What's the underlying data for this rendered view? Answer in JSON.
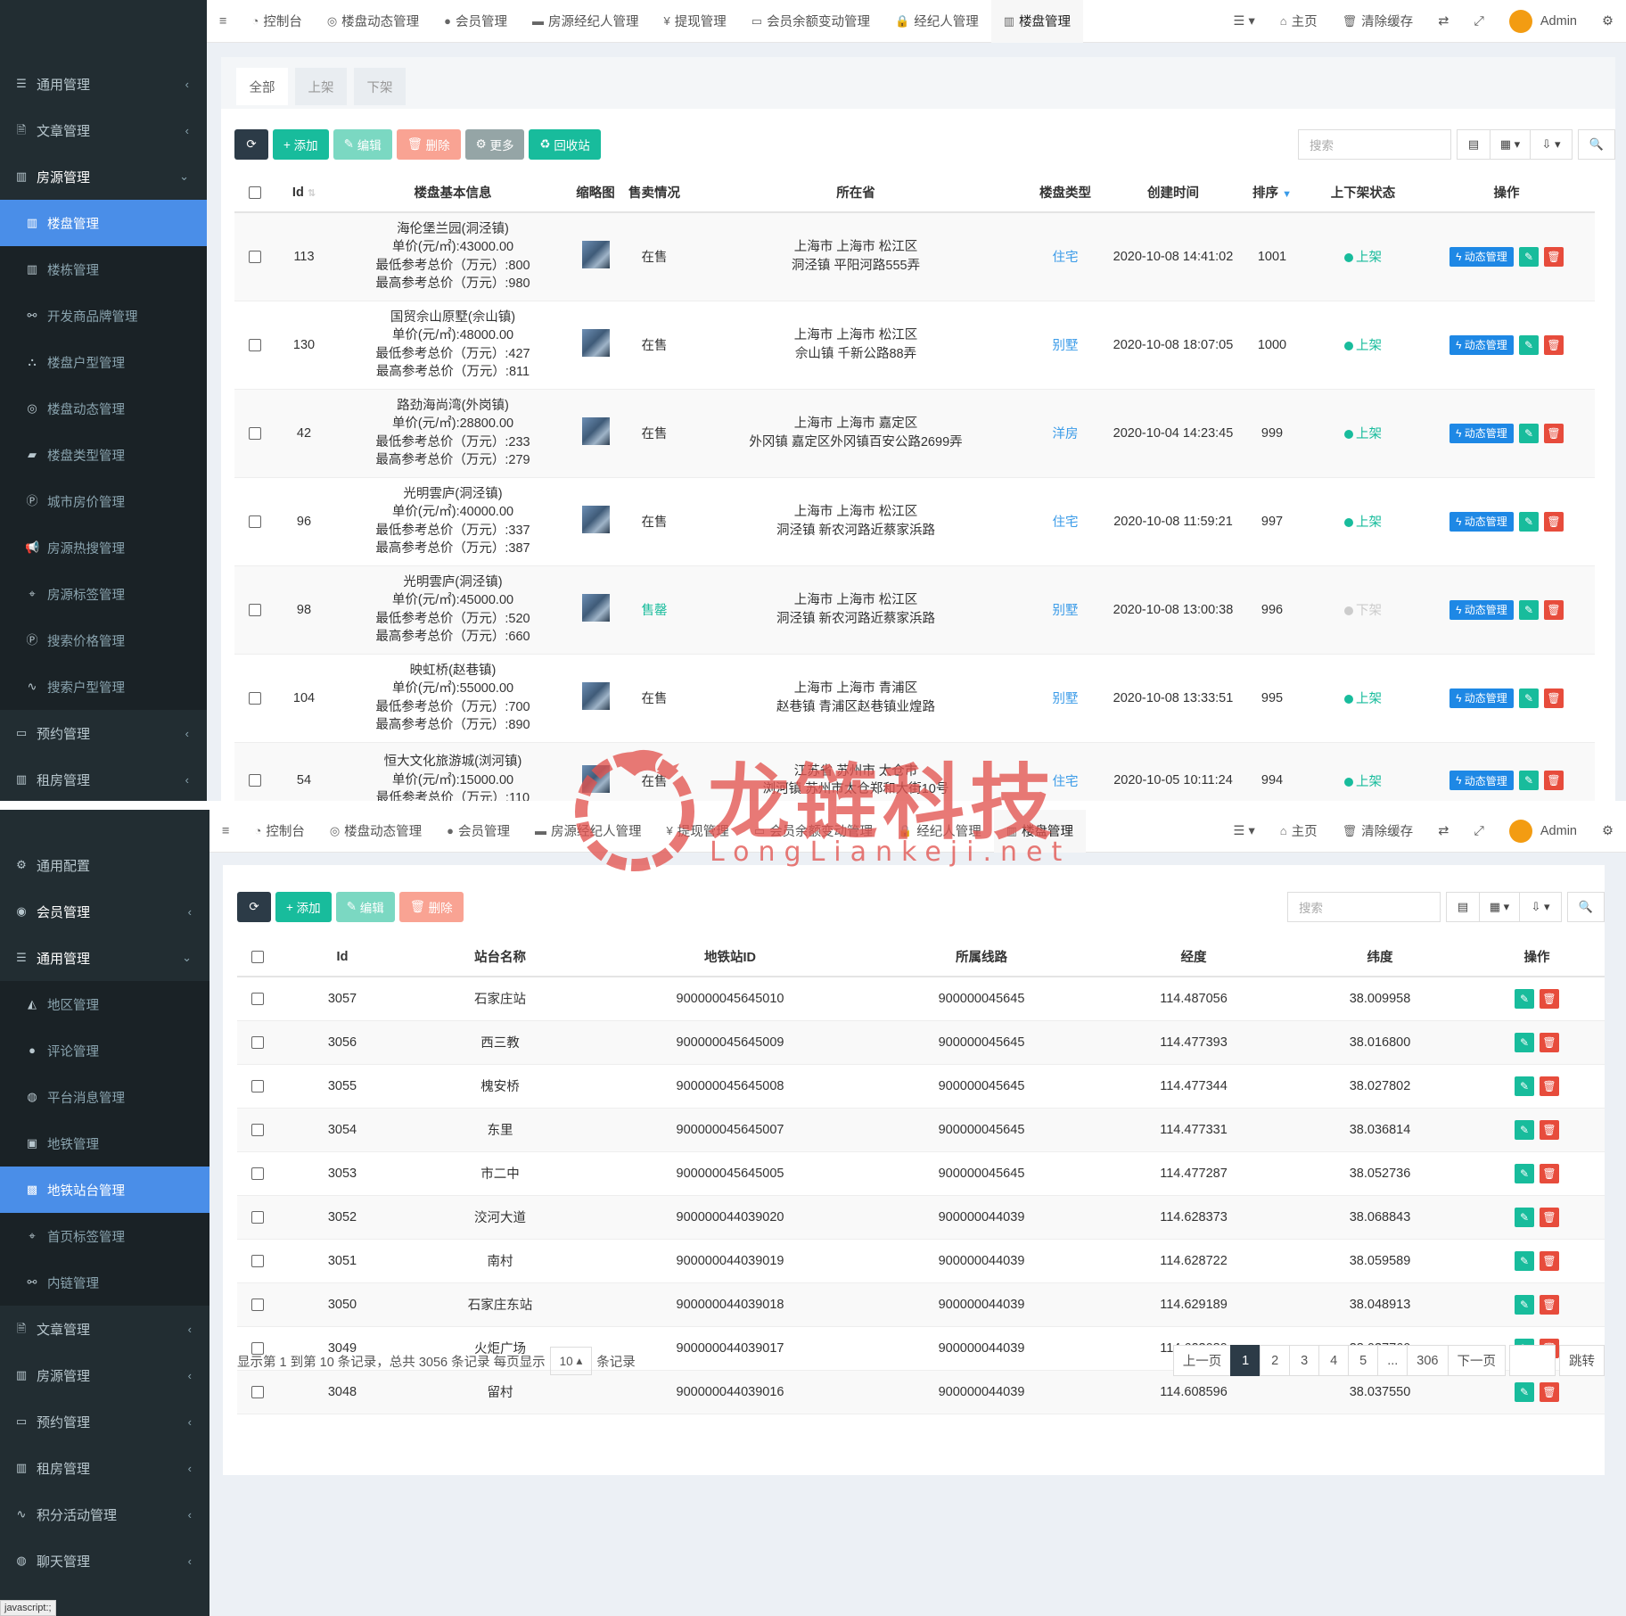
{
  "panel1": {
    "sidebar": [
      {
        "label": "通用管理",
        "icon": "list-icon",
        "kind": "top",
        "arrow": "‹"
      },
      {
        "label": "文章管理",
        "icon": "file-icon",
        "kind": "top",
        "arrow": "‹"
      },
      {
        "label": "房源管理",
        "icon": "building-icon",
        "kind": "top open",
        "arrow": "⌄"
      },
      {
        "label": "楼盘管理",
        "icon": "building-icon",
        "kind": "sub active",
        "arrow": ""
      },
      {
        "label": "楼栋管理",
        "icon": "building-icon",
        "kind": "sub",
        "arrow": ""
      },
      {
        "label": "开发商品牌管理",
        "icon": "link-icon",
        "kind": "sub",
        "arrow": ""
      },
      {
        "label": "楼盘户型管理",
        "icon": "sitemap-icon",
        "kind": "sub",
        "arrow": ""
      },
      {
        "label": "楼盘动态管理",
        "icon": "glasses-icon",
        "kind": "sub",
        "arrow": ""
      },
      {
        "label": "楼盘类型管理",
        "icon": "book-icon",
        "kind": "sub",
        "arrow": ""
      },
      {
        "label": "城市房价管理",
        "icon": "parking-icon",
        "kind": "sub",
        "arrow": ""
      },
      {
        "label": "房源热搜管理",
        "icon": "bullhorn-icon",
        "kind": "sub",
        "arrow": ""
      },
      {
        "label": "房源标签管理",
        "icon": "tag-icon",
        "kind": "sub",
        "arrow": ""
      },
      {
        "label": "搜索价格管理",
        "icon": "parking-icon",
        "kind": "sub",
        "arrow": ""
      },
      {
        "label": "搜索户型管理",
        "icon": "chart-icon",
        "kind": "sub",
        "arrow": ""
      },
      {
        "label": "预约管理",
        "icon": "laptop-icon",
        "kind": "top",
        "arrow": "‹"
      },
      {
        "label": "租房管理",
        "icon": "building-icon",
        "kind": "top",
        "arrow": "‹"
      }
    ],
    "nav": [
      {
        "label": "控制台",
        "icon": "dashboard-icon"
      },
      {
        "label": "楼盘动态管理",
        "icon": "glasses-icon"
      },
      {
        "label": "会员管理",
        "icon": "user-icon"
      },
      {
        "label": "房源经纪人管理",
        "icon": "briefcase-icon"
      },
      {
        "label": "提现管理",
        "icon": "yen-icon"
      },
      {
        "label": "会员余额变动管理",
        "icon": "money-icon"
      },
      {
        "label": "经纪人管理",
        "icon": "lock-icon"
      },
      {
        "label": "楼盘管理",
        "icon": "building-icon"
      }
    ],
    "home": "主页",
    "clear_cache": "清除缓存",
    "admin": "Admin",
    "tabs": [
      "全部",
      "上架",
      "下架"
    ],
    "buttons": {
      "add": "添加",
      "edit": "编辑",
      "delete": "删除",
      "more": "更多",
      "recycle": "回收站"
    },
    "search_placeholder": "搜索",
    "headers": [
      "Id",
      "楼盘基本信息",
      "缩略图",
      "售卖情况",
      "所在省",
      "楼盘类型",
      "创建时间",
      "排序",
      "上下架状态",
      "操作"
    ],
    "op_dynamic": "动态管理",
    "rows": [
      {
        "id": "113",
        "info": [
          "海伦堡兰园(洞泾镇)",
          "单价(元/㎡):43000.00",
          "最低参考总价（万元）:800",
          "最高参考总价（万元）:980"
        ],
        "sale": "在售",
        "sale_green": false,
        "loc": [
          "上海市 上海市 松江区",
          "洞泾镇 平阳河路555弄"
        ],
        "type": "住宅",
        "time": "2020-10-08 14:41:02",
        "sort": "1001",
        "status": "上架",
        "on": true
      },
      {
        "id": "130",
        "info": [
          "国贸佘山原墅(佘山镇)",
          "单价(元/㎡):48000.00",
          "最低参考总价（万元）:427",
          "最高参考总价（万元）:811"
        ],
        "sale": "在售",
        "sale_green": false,
        "loc": [
          "上海市 上海市 松江区",
          "佘山镇 千新公路88弄"
        ],
        "type": "别墅",
        "time": "2020-10-08 18:07:05",
        "sort": "1000",
        "status": "上架",
        "on": true
      },
      {
        "id": "42",
        "info": [
          "路劲海尚湾(外岗镇)",
          "单价(元/㎡):28800.00",
          "最低参考总价（万元）:233",
          "最高参考总价（万元）:279"
        ],
        "sale": "在售",
        "sale_green": false,
        "loc": [
          "上海市 上海市 嘉定区",
          "外冈镇 嘉定区外冈镇百安公路2699弄"
        ],
        "type": "洋房",
        "time": "2020-10-04 14:23:45",
        "sort": "999",
        "status": "上架",
        "on": true
      },
      {
        "id": "96",
        "info": [
          "光明雲庐(洞泾镇)",
          "单价(元/㎡):40000.00",
          "最低参考总价（万元）:337",
          "最高参考总价（万元）:387"
        ],
        "sale": "在售",
        "sale_green": false,
        "loc": [
          "上海市 上海市 松江区",
          "洞泾镇 新农河路近蔡家浜路"
        ],
        "type": "住宅",
        "time": "2020-10-08 11:59:21",
        "sort": "997",
        "status": "上架",
        "on": true
      },
      {
        "id": "98",
        "info": [
          "光明雲庐(洞泾镇)",
          "单价(元/㎡):45000.00",
          "最低参考总价（万元）:520",
          "最高参考总价（万元）:660"
        ],
        "sale": "售罄",
        "sale_green": true,
        "loc": [
          "上海市 上海市 松江区",
          "洞泾镇 新农河路近蔡家浜路"
        ],
        "type": "别墅",
        "time": "2020-10-08 13:00:38",
        "sort": "996",
        "status": "下架",
        "on": false
      },
      {
        "id": "104",
        "info": [
          "映虹桥(赵巷镇)",
          "单价(元/㎡):55000.00",
          "最低参考总价（万元）:700",
          "最高参考总价（万元）:890"
        ],
        "sale": "在售",
        "sale_green": false,
        "loc": [
          "上海市 上海市 青浦区",
          "赵巷镇 青浦区赵巷镇业煌路"
        ],
        "type": "别墅",
        "time": "2020-10-08 13:33:51",
        "sort": "995",
        "status": "上架",
        "on": true
      },
      {
        "id": "54",
        "info": [
          "恒大文化旅游城(浏河镇)",
          "单价(元/㎡):15000.00",
          "最低参考总价（万元）:110"
        ],
        "sale": "在售",
        "sale_green": false,
        "loc": [
          "江苏省 苏州市 太仓市",
          "浏河镇 苏州市太仓郑和大街10号"
        ],
        "type": "住宅",
        "time": "2020-10-05 10:11:24",
        "sort": "994",
        "status": "上架",
        "on": true
      }
    ]
  },
  "panel2": {
    "sidebar": [
      {
        "label": "通用配置",
        "icon": "gear-icon",
        "kind": "top",
        "arrow": ""
      },
      {
        "label": "会员管理",
        "icon": "user-circle-icon",
        "kind": "top open",
        "arrow": "‹"
      },
      {
        "label": "通用管理",
        "icon": "list-icon",
        "kind": "top open",
        "arrow": "⌄"
      },
      {
        "label": "地区管理",
        "icon": "area-chart-icon",
        "kind": "sub",
        "arrow": ""
      },
      {
        "label": "评论管理",
        "icon": "comment-icon",
        "kind": "sub",
        "arrow": ""
      },
      {
        "label": "平台消息管理",
        "icon": "comments-icon",
        "kind": "sub",
        "arrow": ""
      },
      {
        "label": "地铁管理",
        "icon": "subway-icon",
        "kind": "sub",
        "arrow": ""
      },
      {
        "label": "地铁站台管理",
        "icon": "station-icon",
        "kind": "sub active",
        "arrow": ""
      },
      {
        "label": "首页标签管理",
        "icon": "tag-icon",
        "kind": "sub",
        "arrow": ""
      },
      {
        "label": "内链管理",
        "icon": "link-icon",
        "kind": "sub",
        "arrow": ""
      },
      {
        "label": "文章管理",
        "icon": "file-icon",
        "kind": "top",
        "arrow": "‹"
      },
      {
        "label": "房源管理",
        "icon": "building-icon",
        "kind": "top",
        "arrow": "‹"
      },
      {
        "label": "预约管理",
        "icon": "laptop-icon",
        "kind": "top",
        "arrow": "‹"
      },
      {
        "label": "租房管理",
        "icon": "building-icon",
        "kind": "top",
        "arrow": "‹"
      },
      {
        "label": "积分活动管理",
        "icon": "chart-icon",
        "kind": "top",
        "arrow": "‹"
      },
      {
        "label": "聊天管理",
        "icon": "comments-icon",
        "kind": "top",
        "arrow": "‹"
      }
    ],
    "nav": [
      {
        "label": "控制台",
        "icon": "dashboard-icon"
      },
      {
        "label": "楼盘动态管理",
        "icon": "glasses-icon"
      },
      {
        "label": "会员管理",
        "icon": "user-icon"
      },
      {
        "label": "房源经纪人管理",
        "icon": "briefcase-icon"
      },
      {
        "label": "提现管理",
        "icon": "yen-icon"
      },
      {
        "label": "会员余额变动管理",
        "icon": "money-icon"
      },
      {
        "label": "经纪人管理",
        "icon": "lock-icon"
      },
      {
        "label": "楼盘管理",
        "icon": "building-icon"
      }
    ],
    "home": "主页",
    "clear_cache": "清除缓存",
    "admin": "Admin",
    "buttons": {
      "add": "添加",
      "edit": "编辑",
      "delete": "删除"
    },
    "search_placeholder": "搜索",
    "headers": [
      "Id",
      "站台名称",
      "地铁站ID",
      "所属线路",
      "经度",
      "纬度",
      "操作"
    ],
    "rows": [
      [
        "3057",
        "石家庄站",
        "900000045645010",
        "900000045645",
        "114.487056",
        "38.009958"
      ],
      [
        "3056",
        "西三教",
        "900000045645009",
        "900000045645",
        "114.477393",
        "38.016800"
      ],
      [
        "3055",
        "槐安桥",
        "900000045645008",
        "900000045645",
        "114.477344",
        "38.027802"
      ],
      [
        "3054",
        "东里",
        "900000045645007",
        "900000045645",
        "114.477331",
        "38.036814"
      ],
      [
        "3053",
        "市二中",
        "900000045645005",
        "900000045645",
        "114.477287",
        "38.052736"
      ],
      [
        "3052",
        "洨河大道",
        "900000044039020",
        "900000044039",
        "114.628373",
        "38.068843"
      ],
      [
        "3051",
        "南村",
        "900000044039019",
        "900000044039",
        "114.628722",
        "38.059589"
      ],
      [
        "3050",
        "石家庄东站",
        "900000044039018",
        "900000044039",
        "114.629189",
        "38.048913"
      ],
      [
        "3049",
        "火炬广场",
        "900000044039017",
        "900000044039",
        "114.623089",
        "38.037760"
      ],
      [
        "3048",
        "留村",
        "900000044039016",
        "900000044039",
        "114.608596",
        "38.037550"
      ]
    ],
    "footer": {
      "summary": "显示第 1 到第 10 条记录，总共 3056 条记录 每页显示",
      "per_page": "10",
      "suffix": "条记录"
    },
    "pager": {
      "prev": "上一页",
      "pages": [
        "1",
        "2",
        "3",
        "4",
        "5",
        "...",
        "306"
      ],
      "next": "下一页",
      "go": "跳转"
    }
  },
  "watermark": {
    "title": "龙链科技",
    "sub": "LongLiankeji.net"
  },
  "status_bar": "javascript:;"
}
